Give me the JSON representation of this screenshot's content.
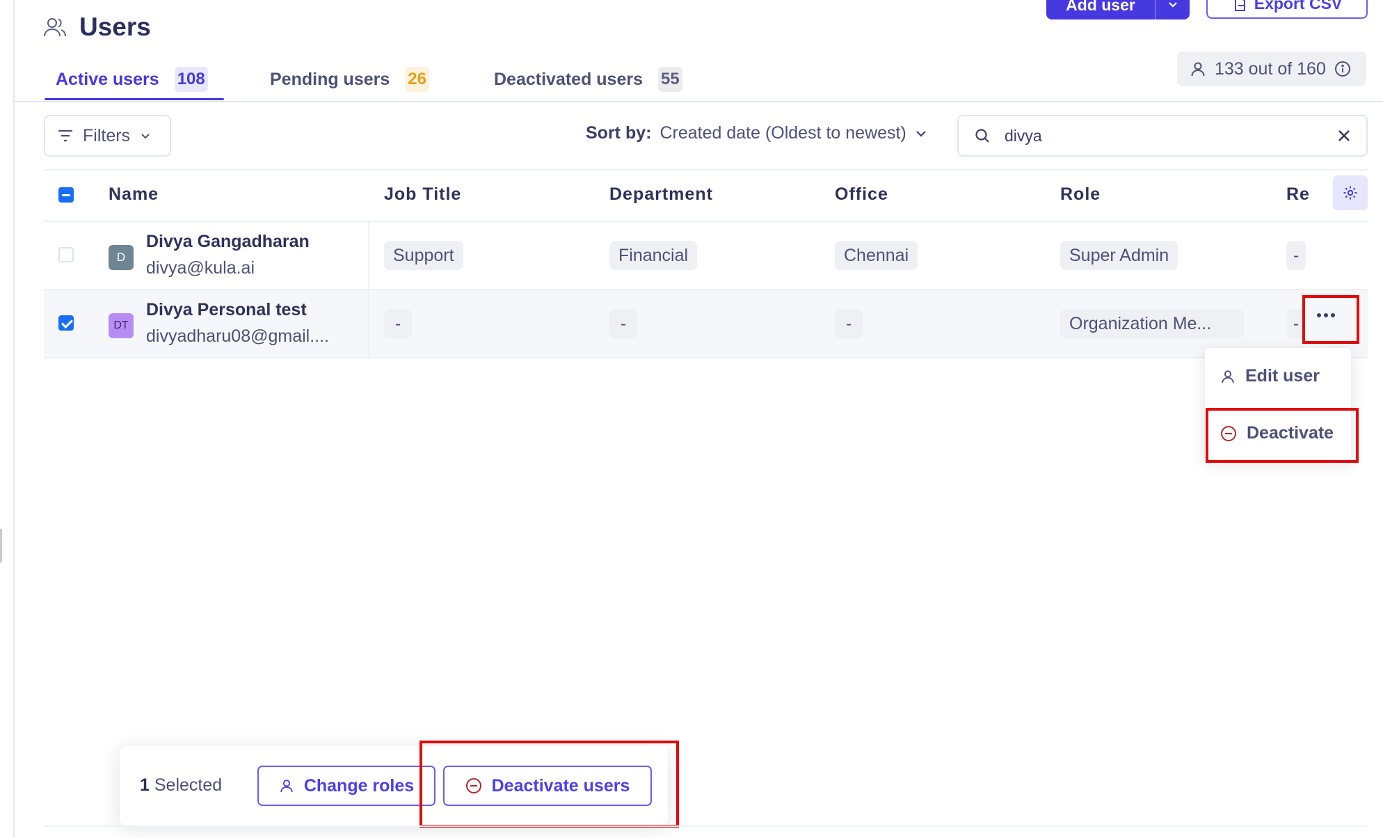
{
  "page": {
    "title": "Users"
  },
  "header": {
    "add_user_label": "Add user",
    "export_label": "Export CSV"
  },
  "tabs": [
    {
      "label": "Active users",
      "count": "108",
      "active": true
    },
    {
      "label": "Pending users",
      "count": "26",
      "active": false
    },
    {
      "label": "Deactivated users",
      "count": "55",
      "active": false
    }
  ],
  "seats": {
    "label": "133 out of 160"
  },
  "toolbar": {
    "filters_label": "Filters",
    "sort_label": "Sort by:",
    "sort_value": "Created date (Oldest to newest)",
    "search_value": "divya"
  },
  "table": {
    "columns": [
      "Name",
      "Job Title",
      "Department",
      "Office",
      "Role",
      "Re"
    ],
    "rows": [
      {
        "initials": "D",
        "name": "Divya Gangadharan",
        "email": "divya@kula.ai",
        "job_title": "Support",
        "department": "Financial",
        "office": "Chennai",
        "role": "Super Admin",
        "extra": "-",
        "checked": false
      },
      {
        "initials": "DT",
        "name": "Divya Personal test",
        "email": "divyadharu08@gmail....",
        "job_title": "-",
        "department": "-",
        "office": "-",
        "role": "Organization Me...",
        "extra": "-",
        "checked": true
      }
    ]
  },
  "row_menu": {
    "edit_label": "Edit user",
    "deactivate_label": "Deactivate"
  },
  "bulk_bar": {
    "selected_count": "1",
    "selected_label": "Selected",
    "change_roles_label": "Change roles",
    "deactivate_users_label": "Deactivate users"
  },
  "colors": {
    "accent": "#4639e0",
    "highlight": "#e00a0a",
    "danger_icon": "#b3262e"
  }
}
